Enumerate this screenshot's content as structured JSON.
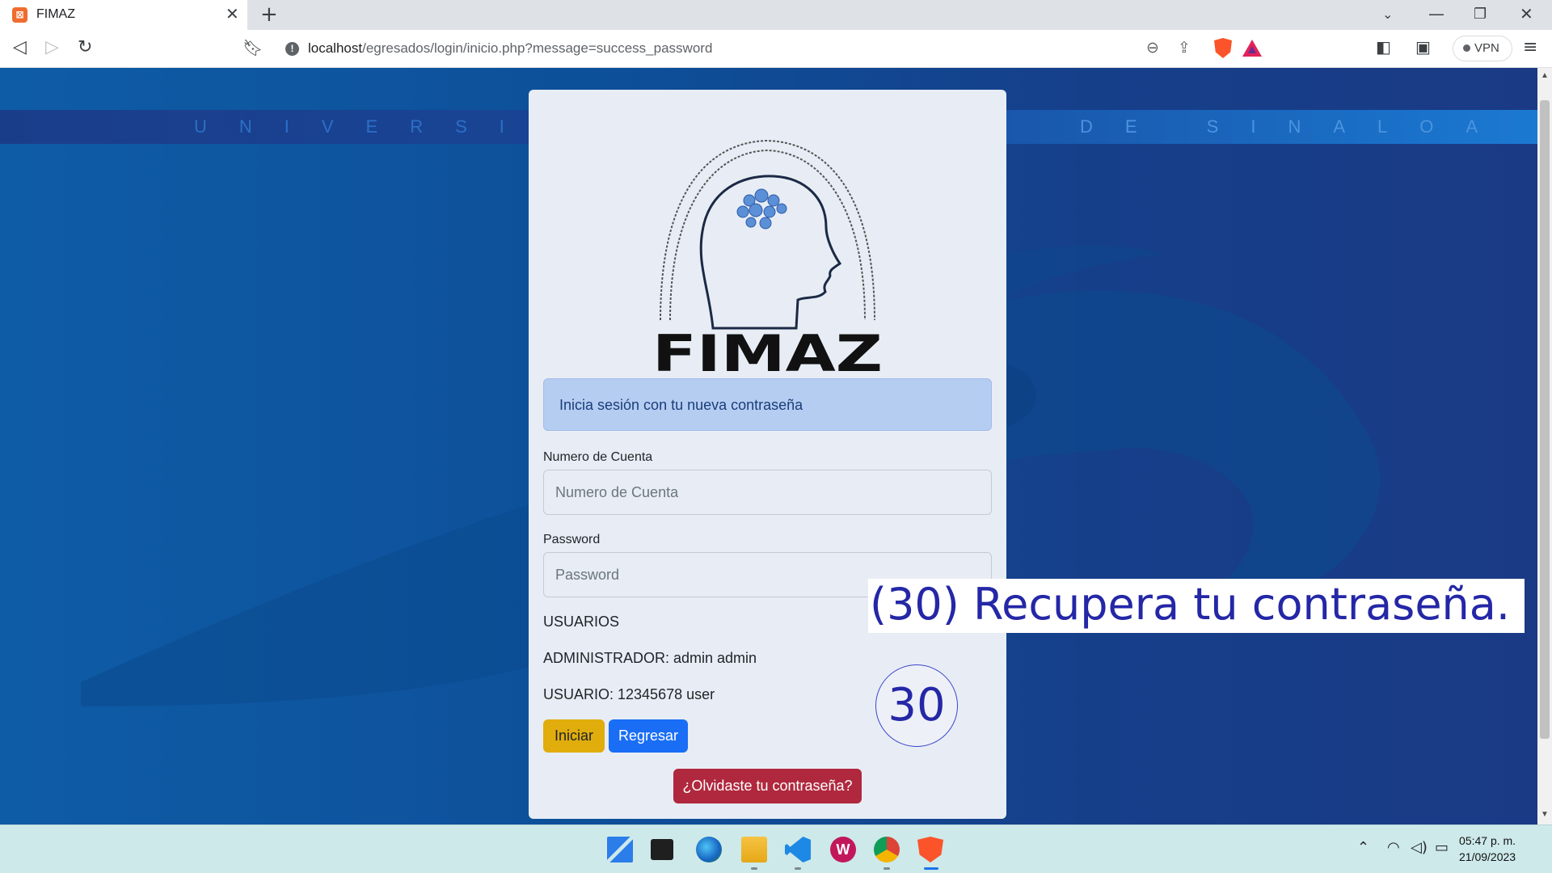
{
  "browser": {
    "tab_title": "FIMAZ",
    "tab_favicon": "xampp-icon",
    "url_host": "localhost",
    "url_path": "/egresados/login/inicio.php?message=success_password",
    "vpn_label": "VPN"
  },
  "page": {
    "banner_left": "UNIVERSI",
    "banner_right": "DE SINALOA",
    "logo_text": "FIMAZ",
    "alert": "Inicia sesión con tu nueva contraseña",
    "account_label": "Numero de Cuenta",
    "account_placeholder": "Numero de Cuenta",
    "password_label": "Password",
    "password_placeholder": "Password",
    "users_heading": "USUARIOS",
    "admin_info": "ADMINISTRADOR: admin admin",
    "user_info": "USUARIO: 12345678 user",
    "start_button": "Iniciar",
    "back_button": "Regresar",
    "forgot_button": "¿Olvidaste tu contraseña?"
  },
  "annotation": {
    "step_number": "30",
    "caption": "(30) Recupera tu contraseña."
  },
  "taskbar": {
    "time": "05:47 p. m.",
    "date": "21/09/2023"
  },
  "colors": {
    "alert_bg": "#b6cdf2",
    "start_button": "#e0ad0c",
    "back_button": "#1a6ef5",
    "forgot_button": "#b0283d",
    "annotation": "#2427a6"
  }
}
